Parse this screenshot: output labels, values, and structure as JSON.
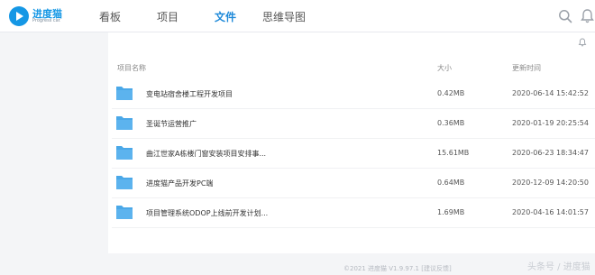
{
  "brand": {
    "name": "进度猫",
    "subtitle": "Progress cat"
  },
  "nav": {
    "items": [
      {
        "label": "看板"
      },
      {
        "label": "项目"
      },
      {
        "label": "文件"
      },
      {
        "label": "思维导图"
      }
    ],
    "active": "文件"
  },
  "table": {
    "columns": {
      "name": "项目名称",
      "size": "大小",
      "time": "更新时间"
    },
    "rows": [
      {
        "name": "变电站宿舍楼工程开发项目",
        "size": "0.42MB",
        "time": "2020-06-14 15:42:52"
      },
      {
        "name": "圣诞节运营推广",
        "size": "0.36MB",
        "time": "2020-01-19 20:25:54"
      },
      {
        "name": "曲江世家A栋楼门窗安装项目安排事...",
        "size": "15.61MB",
        "time": "2020-06-23 18:34:47"
      },
      {
        "name": "进度猫产品开发PC端",
        "size": "0.64MB",
        "time": "2020-12-09 14:20:50"
      },
      {
        "name": "项目管理系统ODOP上线前开发计划...",
        "size": "1.69MB",
        "time": "2020-04-16 14:01:57"
      }
    ]
  },
  "footer": {
    "copyright": "©2021 进度猫 V1.9.97.1",
    "feedback": "[建议反馈]"
  },
  "watermark": "头条号 / 进度猫",
  "colors": {
    "accent": "#1f8ad9",
    "folder": "#4aa8e8",
    "background": "#f4f5f7"
  },
  "icons": [
    "search-icon",
    "bell-icon",
    "folder-icon"
  ]
}
